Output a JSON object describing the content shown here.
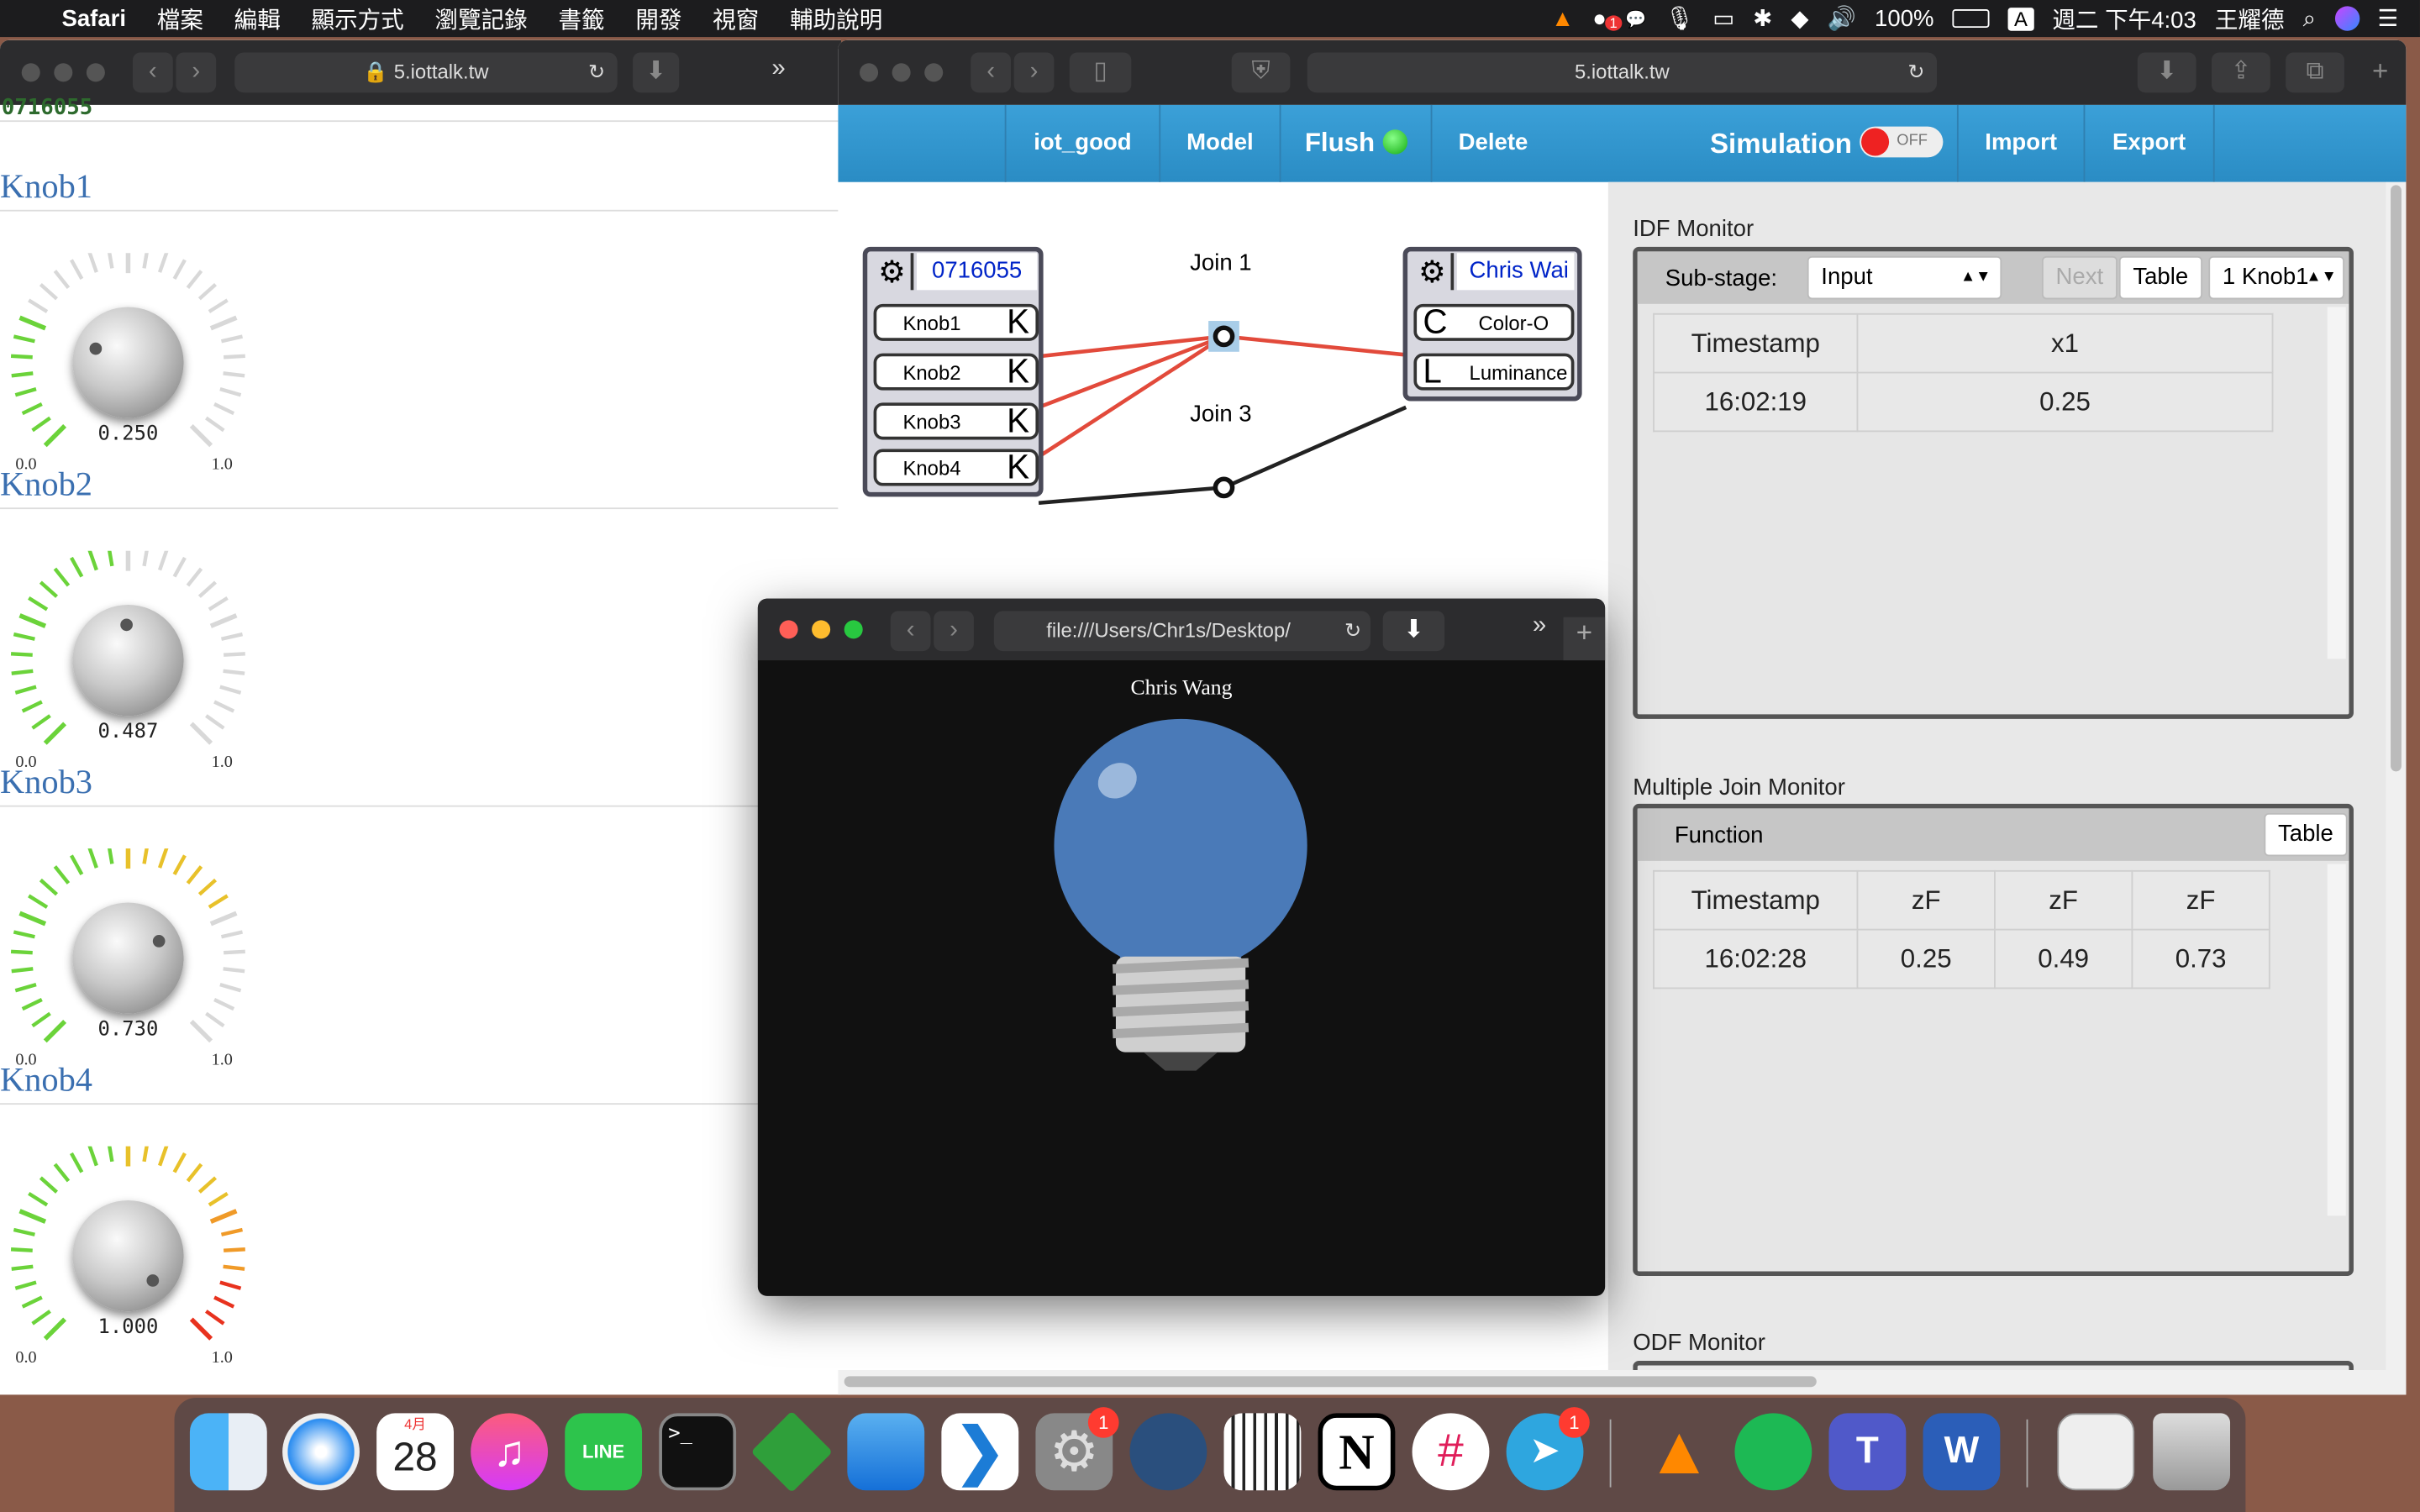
{
  "menubar": {
    "app": "Safari",
    "items": [
      "檔案",
      "編輯",
      "顯示方式",
      "瀏覽記錄",
      "書籤",
      "開發",
      "視窗",
      "輔助說明"
    ],
    "battery": "100%",
    "input_source": "A",
    "datetime": "週二 下午4:03",
    "user": "王耀德",
    "notification_badge": "1"
  },
  "left_window": {
    "url": "5.iottalk.tw",
    "device_id": "0716055",
    "knobs": [
      {
        "title": "Knob1",
        "value": "0.250",
        "min": "0.0",
        "max": "1.0",
        "level": 0.25
      },
      {
        "title": "Knob2",
        "value": "0.487",
        "min": "0.0",
        "max": "1.0",
        "level": 0.487
      },
      {
        "title": "Knob3",
        "value": "0.730",
        "min": "0.0",
        "max": "1.0",
        "level": 0.73
      },
      {
        "title": "Knob4",
        "value": "1.000",
        "min": "0.0",
        "max": "1.0",
        "level": 1.0
      }
    ]
  },
  "right_window": {
    "url": "5.iottalk.tw",
    "toolbar": {
      "project": "iot_good",
      "model": "Model",
      "flush": "Flush",
      "delete": "Delete",
      "simulation": "Simulation",
      "sim_state": "OFF",
      "import": "Import",
      "export": "Export"
    },
    "idf_device": {
      "name": "0716055",
      "features": [
        {
          "name": "Knob1",
          "tag": "K"
        },
        {
          "name": "Knob2",
          "tag": "K"
        },
        {
          "name": "Knob3",
          "tag": "K"
        },
        {
          "name": "Knob4",
          "tag": "K"
        }
      ]
    },
    "odf_device": {
      "name": "Chris Wai",
      "features": [
        {
          "name": "Color-O",
          "tag": "C"
        },
        {
          "name": "Luminance",
          "tag": "L"
        }
      ]
    },
    "joins": [
      "Join 1",
      "Join 3"
    ],
    "idf_monitor": {
      "title": "IDF Monitor",
      "substage_label": "Sub-stage:",
      "substage_value": "Input",
      "next": "Next",
      "table": "Table",
      "feature_select": "1 Knob1",
      "headers": [
        "Timestamp",
        "x1"
      ],
      "rows": [
        [
          "16:02:19",
          "0.25"
        ]
      ]
    },
    "join_monitor": {
      "title": "Multiple Join Monitor",
      "function_label": "Function",
      "table": "Table",
      "headers": [
        "Timestamp",
        "zF",
        "zF",
        "zF"
      ],
      "rows": [
        [
          "16:02:28",
          "0.25",
          "0.49",
          "0.73"
        ]
      ]
    },
    "odf_monitor": {
      "title": "ODF Monitor"
    }
  },
  "bulb_window": {
    "url": "file:///Users/Chr1s/Desktop/",
    "caption": "Chris Wang",
    "bulb_color": "#4a7ab8"
  },
  "dock": {
    "apps": [
      "Finder",
      "Safari",
      "Calendar",
      "Music",
      "LINE",
      "Terminal",
      "Vim",
      "Xcode",
      "VS Code",
      "System Preferences",
      "Podcast",
      "Piano",
      "Notion",
      "Slack",
      "Telegram",
      "VLC",
      "Spotify",
      "Teams",
      "Word",
      "Preview",
      "Trash"
    ],
    "calendar_month": "4月",
    "calendar_day": "28",
    "badge_sysprefs": "1",
    "badge_telegram": "1"
  }
}
